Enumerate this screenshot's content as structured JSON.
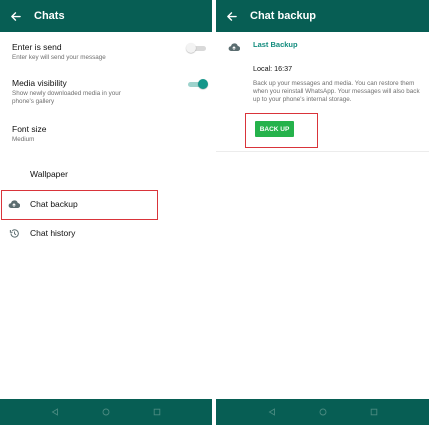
{
  "colors": {
    "primary": "#075e54",
    "accent": "#128c7e",
    "button_green": "#25b24b",
    "highlight_red": "#d9343a"
  },
  "left_screen": {
    "title": "Chats",
    "settings": [
      {
        "name": "Enter is send",
        "description": "Enter key will send your message",
        "toggle": "off"
      },
      {
        "name": "Media visibility",
        "description": "Show newly downloaded media in your phone's gallery",
        "toggle": "on"
      },
      {
        "name": "Font size",
        "description": "Medium"
      }
    ],
    "menu": [
      {
        "label": "Wallpaper",
        "icon": "wallpaper-icon"
      },
      {
        "label": "Chat backup",
        "icon": "cloud-upload-icon"
      },
      {
        "label": "Chat history",
        "icon": "history-icon"
      }
    ]
  },
  "right_screen": {
    "title": "Chat backup",
    "section_title": "Last Backup",
    "local_label": "Local: 16:37",
    "description": "Back up your messages and media. You can restore them when you reinstall WhatsApp. Your messages will also back up to your phone's internal storage.",
    "button_label": "BACK UP"
  },
  "navbar": {
    "icons": [
      "back-triangle-icon",
      "home-circle-icon",
      "recents-square-icon"
    ]
  }
}
